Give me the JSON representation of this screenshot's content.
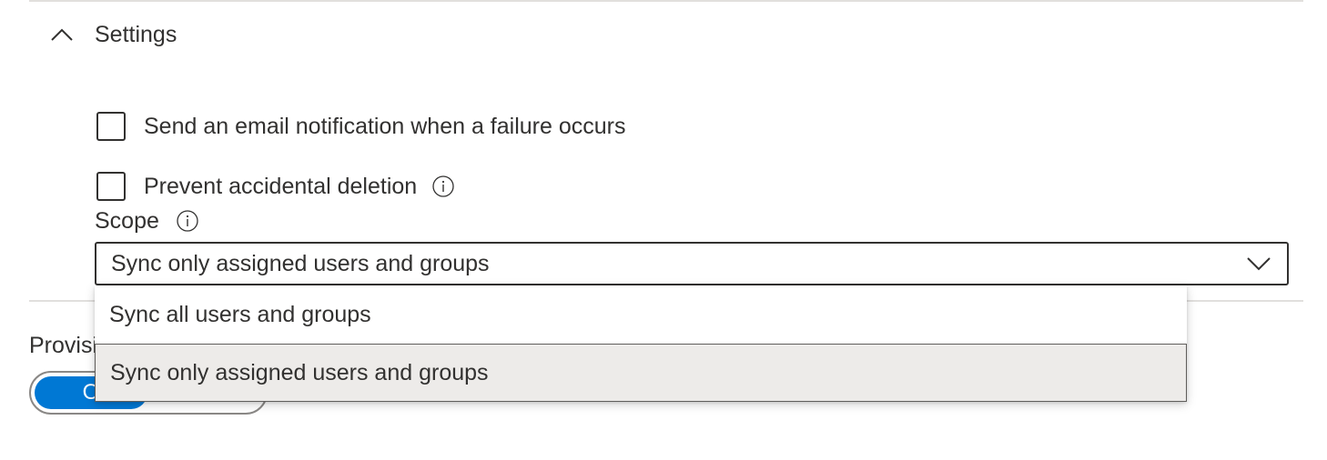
{
  "settings": {
    "section_title": "Settings",
    "expanded": true,
    "email_notification": {
      "label": "Send an email notification when a failure occurs",
      "checked": false
    },
    "prevent_deletion": {
      "label": "Prevent accidental deletion",
      "checked": false
    },
    "scope": {
      "label": "Scope",
      "selected": "Sync only assigned users and groups",
      "options": [
        {
          "label": "Sync all users and groups",
          "highlighted": false
        },
        {
          "label": "Sync only assigned users and groups",
          "highlighted": true
        }
      ]
    }
  },
  "provisioning": {
    "label_visible": "Provisi",
    "toggle_on_visible": "O",
    "toggle_state": "on"
  },
  "colors": {
    "accent": "#0078d4",
    "text": "#323130",
    "divider": "#e1dfdd",
    "option_hover": "#edebe9"
  },
  "icons": {
    "collapse": "chevron-up-icon",
    "info": "info-icon",
    "dropdown": "chevron-down-icon"
  }
}
